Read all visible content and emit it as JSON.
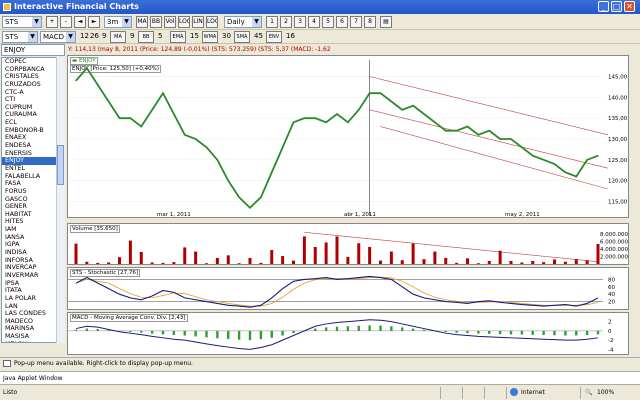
{
  "window": {
    "title": "Interactive Financial Charts",
    "min_label": "_",
    "max_label": "□",
    "close_label": "✕"
  },
  "toolbar1": {
    "symbol": "STS",
    "range": "3m",
    "period": "Daily",
    "buttons": [
      "MA",
      "BB",
      "Vol",
      "LOG",
      "LIN",
      "LOG",
      "LIN",
      "1",
      "2",
      "3",
      "4",
      "5",
      "6",
      "7",
      "8"
    ]
  },
  "toolbar2": {
    "symbol": "STS",
    "indicator": "MACD",
    "params": [
      "12",
      "26",
      "9"
    ],
    "ma_values": [
      "9",
      "5",
      "15",
      "30",
      "45",
      "16"
    ]
  },
  "sidebar": {
    "search_value": "ENJOY",
    "items": [
      "COPEC",
      "CORPBANCA",
      "CRISTALES",
      "CRUZADOS",
      "CTC-A",
      "CTI",
      "CUPRUM",
      "CURAUMA",
      "ECL",
      "EMBONOR-B",
      "ENAEX",
      "ENDESA",
      "ENERSIS",
      "ENJOY",
      "ENTEL",
      "FALABELLA",
      "FASA",
      "FORUS",
      "GASCO",
      "GENER",
      "HABITAT",
      "HITES",
      "IAM",
      "IANSA",
      "IGPA",
      "INDISA",
      "INFORSA",
      "INVERCAP",
      "INVERMAR",
      "IPSA",
      "ITATA",
      "LA POLAR",
      "LAN",
      "LAS CONDES",
      "MADECO",
      "MARINSA",
      "MASISA",
      "MELON"
    ],
    "active_item": "ENJOY"
  },
  "chart": {
    "info_line": "Y: 114,13 (may 8, 2011 (Price: 124,89 (-0,01%) (STS: 573.259) (STS: 5,37 (MACD: -1,62",
    "legend": "ENJOY",
    "price_label": "ENJOY [Price: 125,50] (+0,40%)",
    "volume_label": "Volume [35.650]",
    "stoch_label": "STS - Stochastic [27,76]",
    "macd_label": "MACD - Moving Average Conv. Div. [2,43]",
    "price_ticks": [
      "145,00",
      "140,00",
      "135,00",
      "130,00",
      "125,00",
      "120,00",
      "115,00"
    ],
    "volume_ticks": [
      "8.000.000",
      "6.000.000",
      "4.000.000",
      "2.000.000"
    ],
    "stoch_ticks": [
      "80",
      "60",
      "40",
      "20"
    ],
    "macd_ticks": [
      "2",
      "0",
      "-2",
      "-4"
    ],
    "x_labels": [
      "mar 1, 2011",
      "abr 1, 2011",
      "may 2, 2011"
    ]
  },
  "chart_data": {
    "type": "line",
    "title": "ENJOY [Price: 125,50] (+0,40%)",
    "ylim": [
      112,
      148
    ],
    "x_labels": [
      "mar 1, 2011",
      "abr 1, 2011",
      "may 2, 2011"
    ],
    "series": [
      {
        "name": "ENJOY",
        "values": [
          144,
          147,
          143,
          139,
          135,
          135,
          133,
          137,
          141,
          136,
          131,
          130,
          128,
          125,
          120,
          116,
          113.5,
          116,
          122,
          128,
          134,
          135,
          135,
          134,
          136,
          134,
          137,
          141,
          141,
          139,
          137,
          138,
          136,
          134,
          132,
          132,
          133,
          131,
          132,
          130,
          130,
          128,
          126,
          125,
          124,
          122,
          121,
          125,
          126
        ]
      }
    ],
    "volume": [
      5.4,
      0.6,
      0.3,
      0.4,
      1.8,
      6.2,
      3.2,
      0.4,
      0.3,
      0.5,
      4.4,
      3.3,
      0.2,
      1.6,
      2.3,
      0.2,
      1.6,
      0.3,
      3.7,
      2.1,
      0.9,
      7.3,
      4.5,
      5.7,
      7.3,
      1.9,
      5.5,
      4.5,
      0.9,
      3.3,
      1.0,
      5.4,
      1.3,
      3.3,
      1.6,
      0.3,
      1.5,
      0.2,
      0.8,
      3.5,
      0.8,
      0.4,
      0.8,
      0.5,
      1.2,
      0.6,
      1.3,
      1.0,
      5.3
    ],
    "stochastic": [
      70,
      85,
      70,
      55,
      40,
      30,
      25,
      35,
      50,
      45,
      30,
      25,
      20,
      15,
      10,
      8,
      5,
      10,
      30,
      55,
      75,
      80,
      82,
      85,
      80,
      82,
      85,
      88,
      85,
      80,
      60,
      40,
      30,
      25,
      20,
      18,
      15,
      20,
      22,
      18,
      15,
      12,
      10,
      8,
      10,
      12,
      8,
      15,
      30
    ],
    "macd_hist": [
      0.5,
      1.0,
      0.8,
      0.3,
      -0.2,
      -0.5,
      -0.8,
      -1.2,
      -1.5,
      -1.8,
      -2.0,
      -2.4,
      -2.8,
      -3.2,
      -3.5,
      -3.8,
      -4.0,
      -3.6,
      -3.0,
      -2.0,
      -1.0,
      0,
      1.0,
      1.5,
      1.8,
      2.0,
      2.2,
      2.4,
      2.3,
      2.0,
      1.5,
      1.0,
      0.5,
      0,
      -0.5,
      -0.8,
      -1.0,
      -1.2,
      -1.3,
      -1.4,
      -1.5,
      -1.6,
      -1.7,
      -1.8,
      -1.9,
      -2.0,
      -2.0,
      -1.8,
      -1.5
    ]
  },
  "status": {
    "popup_text": "Pop-up menu available. Right-click to display pop-up menu.",
    "applet_text": "Java Applet Window",
    "ready": "Listo",
    "zone": "Internet",
    "zoom": "100%"
  },
  "colors": {
    "titlebar": "#2456c8",
    "price_line": "#2a8a2a",
    "volume_bar": "#b00000",
    "trend": "#c04040",
    "stoch_k": "#1a1a80",
    "stoch_d": "#e0a020",
    "macd_pos": "#30a030"
  }
}
